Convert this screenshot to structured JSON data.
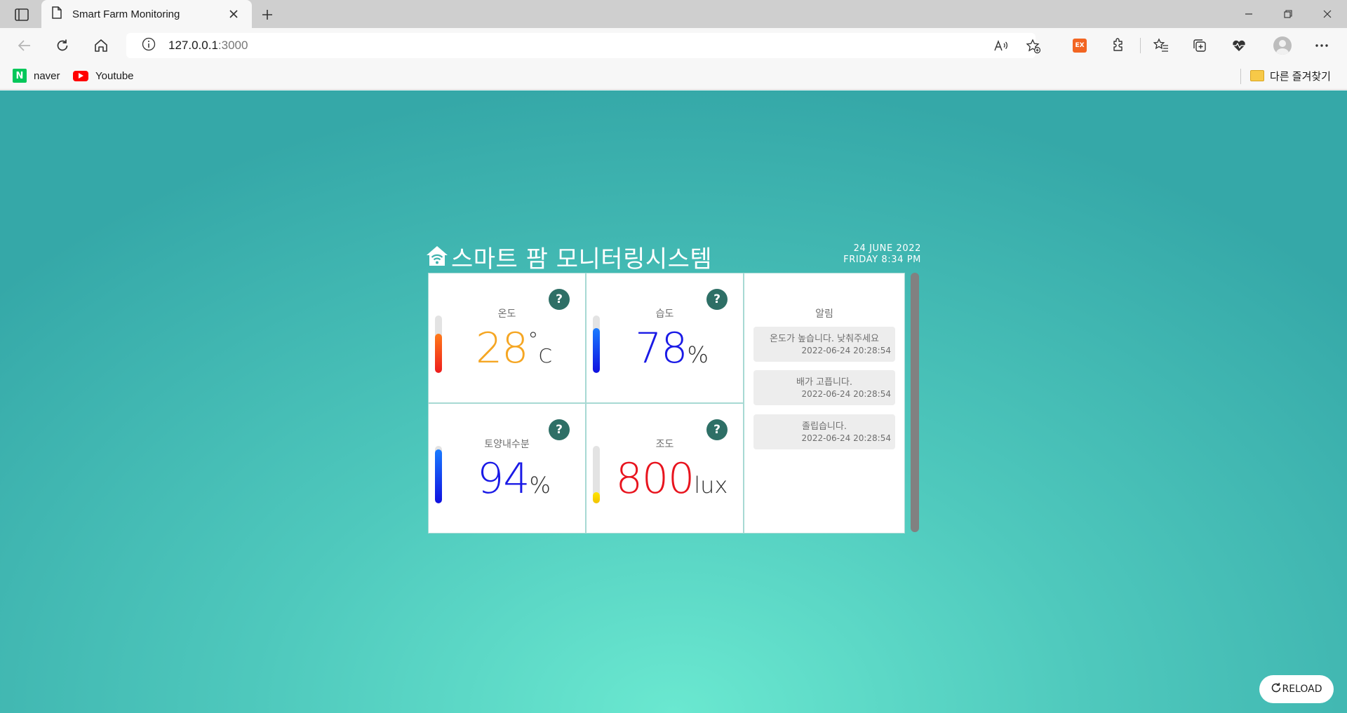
{
  "browser": {
    "tab_title": "Smart Farm Monitoring",
    "address_host": "127.0.0.1",
    "address_port": ":3000",
    "bookmarks": [
      {
        "label": "naver",
        "icon": "naver-icon"
      },
      {
        "label": "Youtube",
        "icon": "youtube-icon"
      }
    ],
    "other_favorites": "다른 즐겨찾기",
    "extension_badge": "EX"
  },
  "dashboard": {
    "title": "스마트 팜 모니터링시스템",
    "date": "24 JUNE 2022",
    "day_time": "FRIDAY 8:34 PM",
    "help_label": "?",
    "sensors": {
      "temperature": {
        "label": "온도",
        "value": "28",
        "unit_deg": "°",
        "unit": "C",
        "level": 0.68,
        "color": "#f5a623"
      },
      "humidity": {
        "label": "습도",
        "value": "78",
        "unit": "%",
        "level": 0.78,
        "color": "#1a1ae6"
      },
      "soil": {
        "label": "토양내수분",
        "value": "94",
        "unit": "%",
        "level": 0.94,
        "color": "#1a1ae6"
      },
      "light": {
        "label": "조도",
        "value": "800",
        "unit": "lux",
        "level": 0.2,
        "color": "#e8141e"
      }
    },
    "alerts": {
      "title": "알림",
      "items": [
        {
          "message": "온도가 높습니다. 낮춰주세요",
          "time": "2022-06-24 20:28:54"
        },
        {
          "message": "배가 고픕니다.",
          "time": "2022-06-24 20:28:54"
        },
        {
          "message": "졸립습니다.",
          "time": "2022-06-24 20:28:54"
        }
      ]
    },
    "reload_label": "RELOAD"
  }
}
